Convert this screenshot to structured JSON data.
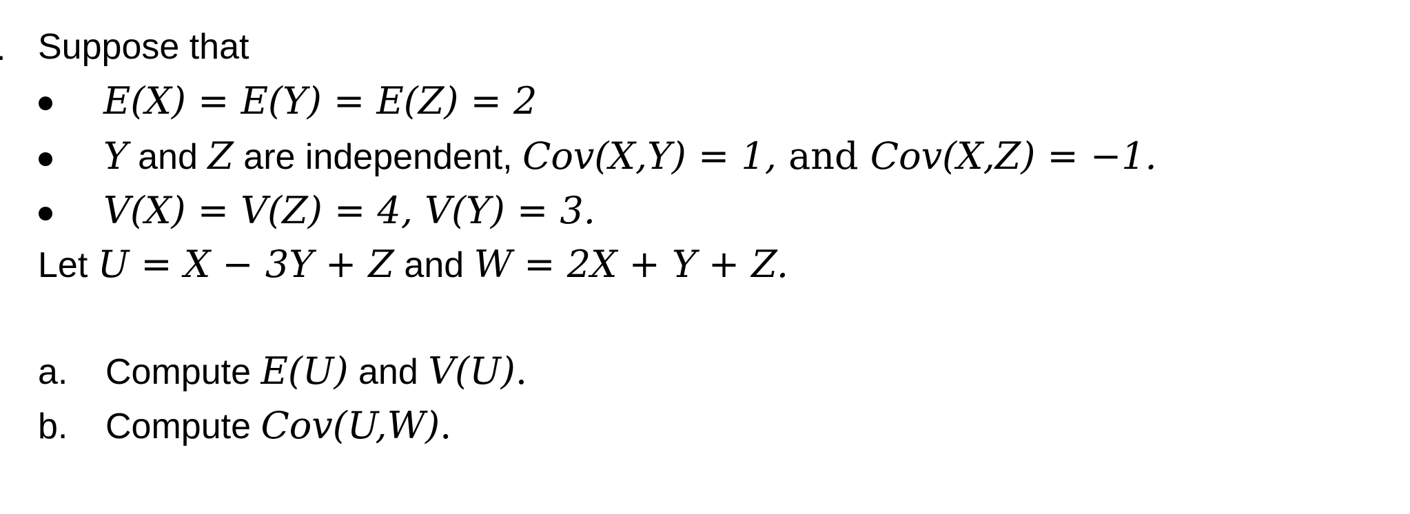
{
  "problem": {
    "number_marker": ".",
    "intro": "Suppose that",
    "bullets": [
      {
        "math": "E(X) = E(Y) = E(Z) = 2"
      },
      {
        "var_y": "Y",
        "text_and": " and ",
        "var_z": "Z",
        "text_indep": " are independent, ",
        "cov1": "Cov(X,Y) = 1,",
        "mid_and": " and ",
        "cov2": "Cov(X,Z) = −1."
      },
      {
        "math": "V(X) = V(Z) = 4,  V(Y) = 3."
      }
    ],
    "let": {
      "prefix": "Let ",
      "u_def": "U = X − 3Y + Z",
      "and": " and ",
      "w_def": "W = 2X + Y + Z."
    },
    "parts": [
      {
        "label": "a.",
        "text1": "Compute ",
        "math1": "E(U)",
        "text2": " and ",
        "math2": "V(U)",
        "end": "."
      },
      {
        "label": "b.",
        "text1": "Compute ",
        "math1": "Cov(U,W)",
        "end": "."
      }
    ]
  }
}
